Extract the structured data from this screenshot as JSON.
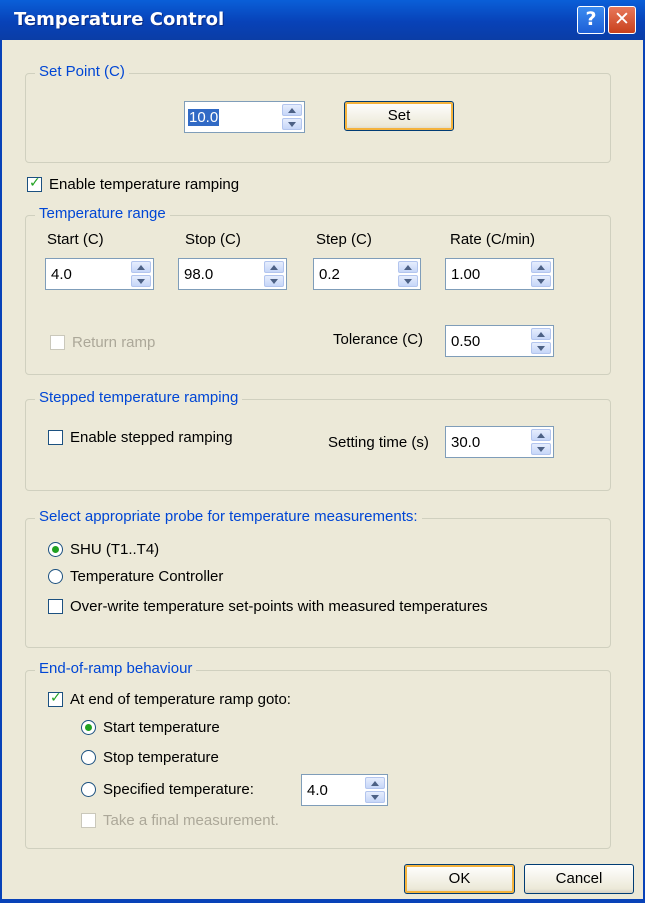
{
  "window": {
    "title": "Temperature Control",
    "help_label": "?",
    "close_label": "✕",
    "help_icon": "question-mark-icon",
    "close_icon": "close-icon"
  },
  "setpoint": {
    "legend": "Set Point (C)",
    "value": "10.0",
    "set_label": "Set"
  },
  "ramping": {
    "enable_label": "Enable temperature ramping",
    "checked": true
  },
  "range": {
    "legend": "Temperature range",
    "start_label": "Start (C)",
    "start_value": "4.0",
    "stop_label": "Stop (C)",
    "stop_value": "98.0",
    "step_label": "Step (C)",
    "step_value": "0.2",
    "rate_label": "Rate (C/min)",
    "rate_value": "1.00",
    "return_label": "Return ramp",
    "tolerance_label": "Tolerance (C)",
    "tolerance_value": "0.50"
  },
  "stepped": {
    "legend": "Stepped temperature ramping",
    "enable_label": "Enable stepped ramping",
    "setting_label": "Setting time (s)",
    "setting_value": "30.0"
  },
  "probe": {
    "legend": "Select appropriate probe for temperature measurements:",
    "shu_label": "SHU (T1..T4)",
    "controller_label": "Temperature Controller",
    "overwrite_label": "Over-write temperature set-points with measured temperatures"
  },
  "endramp": {
    "legend": "End-of-ramp behaviour",
    "goto_label": "At end of temperature ramp goto:",
    "start_label": "Start temperature",
    "stop_label": "Stop temperature",
    "specified_label": "Specified temperature:",
    "specified_value": "4.0",
    "final_label": "Take a final measurement."
  },
  "buttons": {
    "ok": "OK",
    "cancel": "Cancel"
  },
  "colors": {
    "title_bar": "#0842b8",
    "legend_text": "#0046d5",
    "check_green": "#21a121",
    "dialog_bg": "#ece9d8"
  }
}
